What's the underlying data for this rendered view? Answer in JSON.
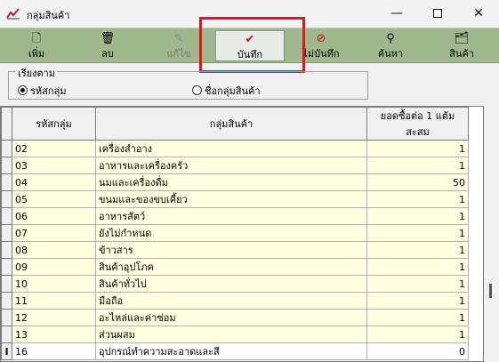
{
  "window": {
    "title": "กลุ่มสินค้า"
  },
  "toolbar": {
    "buttons": [
      {
        "label": "เพิ่ม",
        "icon": "document-new-icon"
      },
      {
        "label": "ลบ",
        "icon": "trash-icon"
      },
      {
        "label": "แก้ไข",
        "icon": "edit-icon"
      },
      {
        "label": "บันทึก",
        "icon": "checkmark-icon"
      },
      {
        "label": "ไม่บันทึก",
        "icon": "cancel-icon"
      },
      {
        "label": "ค้นหา",
        "icon": "search-icon"
      },
      {
        "label": "สินค้า",
        "icon": "products-icon"
      }
    ]
  },
  "sort": {
    "legend": "เรียงตาม",
    "options": [
      "รหัสกลุ่ม",
      "ชื่อกลุ่มสินค้า"
    ],
    "selected": "รหัสกลุ่ม"
  },
  "grid": {
    "columns": [
      "รหัสกลุ่ม",
      "กลุ่มสินค้า",
      "ยอดซื้อต่อ 1 แต้มสะสม"
    ],
    "rows": [
      {
        "code": "02",
        "name": "เครื่องสำอาง",
        "points": "1"
      },
      {
        "code": "03",
        "name": "อาหารและเครื่องครัว",
        "points": "1"
      },
      {
        "code": "04",
        "name": "นมและเครื่องดื่ม",
        "points": "50"
      },
      {
        "code": "05",
        "name": "ขนมและของขบเคี้ยว",
        "points": "1"
      },
      {
        "code": "06",
        "name": "อาหารสัตว์",
        "points": "1"
      },
      {
        "code": "07",
        "name": "ยังไม่กำหนด",
        "points": "1"
      },
      {
        "code": "08",
        "name": "ข้าวสาร",
        "points": "1"
      },
      {
        "code": "09",
        "name": "สินค้าอุปโภค",
        "points": "1"
      },
      {
        "code": "10",
        "name": "สินค้าทั่วไป",
        "points": "1"
      },
      {
        "code": "11",
        "name": "มือถือ",
        "points": "1"
      },
      {
        "code": "12",
        "name": "อะไหล่และค่าซ่อม",
        "points": "1"
      },
      {
        "code": "13",
        "name": "ส่วนผสม",
        "points": "1"
      },
      {
        "code": "16",
        "name": "อุปกรณ์ทำความสะอาดและสี",
        "points": "0"
      }
    ],
    "editing_indicator": "I"
  },
  "colors": {
    "toolbar": "#9fb88d",
    "highlight": "#e8141a",
    "row_fill": "#ffffe1"
  }
}
